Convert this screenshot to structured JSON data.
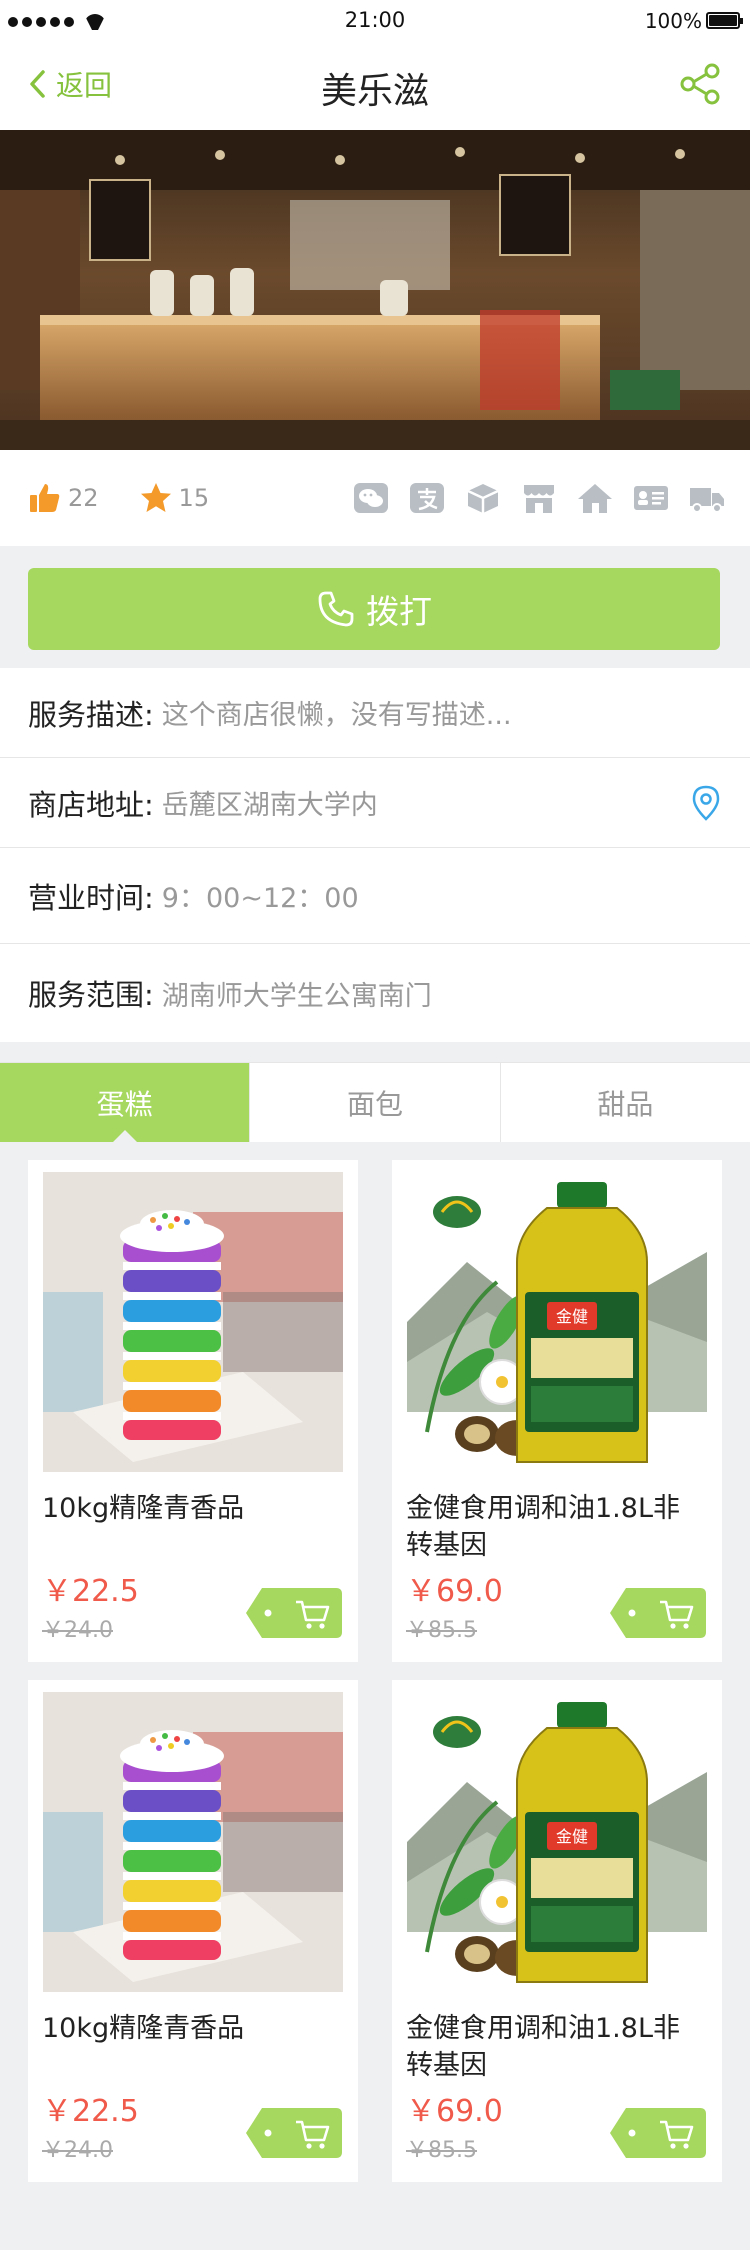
{
  "status_bar": {
    "time": "21:00",
    "battery": "100%"
  },
  "nav": {
    "back_label": "返回",
    "title": "美乐滋"
  },
  "stats": {
    "likes": "22",
    "favorites": "15"
  },
  "call_button": {
    "label": "拨打"
  },
  "info": [
    {
      "label": "服务描述:",
      "value": "这个商店很懒，没有写描述..."
    },
    {
      "label": "商店地址:",
      "value": "岳麓区湖南大学内"
    },
    {
      "label": "营业时间:",
      "value": "9：00~12：00"
    },
    {
      "label": "服务范围:",
      "value": "湖南师大学生公寓南门"
    }
  ],
  "tabs": [
    "蛋糕",
    "面包",
    "甜品"
  ],
  "active_tab": 0,
  "products": [
    {
      "name": "10kg精隆青香品",
      "price": "￥22.5",
      "original_price": "￥24.0",
      "image": "rainbow-cake"
    },
    {
      "name": "金健食用调和油1.8L非转基因",
      "price": "￥69.0",
      "original_price": "￥85.5",
      "image": "oil-bottle"
    },
    {
      "name": "10kg精隆青香品",
      "price": "￥22.5",
      "original_price": "￥24.0",
      "image": "rainbow-cake"
    },
    {
      "name": "金健食用调和油1.8L非转基因",
      "price": "￥69.0",
      "original_price": "￥85.5",
      "image": "oil-bottle"
    }
  ],
  "colors": {
    "accent": "#a6d75e",
    "accent_dark": "#86c23d",
    "price": "#f05a4a",
    "like": "#f39a2b",
    "location": "#3aa7e8"
  }
}
